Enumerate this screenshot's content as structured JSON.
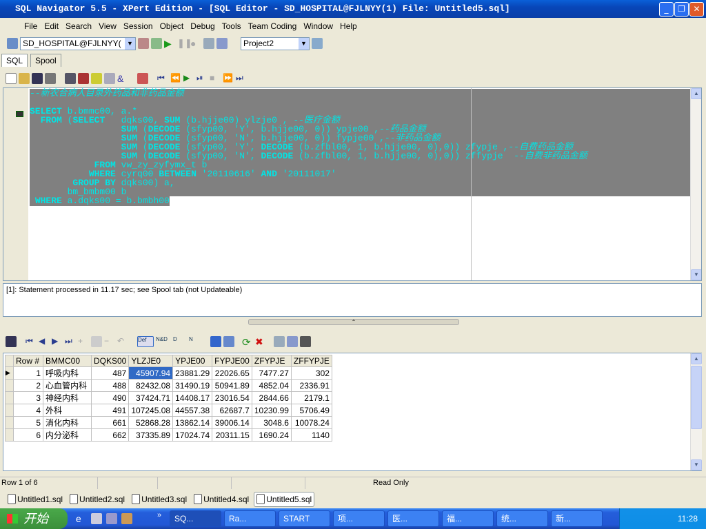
{
  "window": {
    "title": "SQL Navigator 5.5 - XPert Edition - [SQL Editor - SD_HOSPITAL@FJLNYY(1) File: Untitled5.sql]",
    "buttons": [
      "_",
      "❐",
      "✕"
    ]
  },
  "menu": [
    "File",
    "Edit",
    "Search",
    "View",
    "Session",
    "Object",
    "Debug",
    "Tools",
    "Team Coding",
    "Window",
    "Help"
  ],
  "toolbar": {
    "session": "SD_HOSPITAL@FJLNYY(",
    "project": "Project2"
  },
  "tabs": [
    {
      "label": "SQL",
      "active": true
    },
    {
      "label": "Spool",
      "active": false
    }
  ],
  "editor": {
    "lines": [
      [
        [
          "--新农合病人目录外药品和非药品金额",
          "cm"
        ]
      ],
      [],
      [
        [
          "SELECT",
          "kw"
        ],
        [
          " b.bmmc00, a.*",
          ""
        ]
      ],
      [
        [
          "  ",
          ""
        ],
        [
          "FROM",
          "kw"
        ],
        [
          " (",
          ""
        ],
        [
          "SELECT",
          "kw"
        ],
        [
          "   dqks00, ",
          ""
        ],
        [
          "SUM",
          "kw"
        ],
        [
          " (b.hjje00) ylzje0 , ",
          ""
        ],
        [
          "--医疗金额",
          "cm"
        ]
      ],
      [
        [
          "                 ",
          ""
        ],
        [
          "SUM",
          "kw"
        ],
        [
          " (",
          ""
        ],
        [
          "DECODE",
          "kw"
        ],
        [
          " (sfyp00, 'Y', b.hjje00, 0)) ypje00 ,",
          ""
        ],
        [
          "--药品金额",
          "cm"
        ]
      ],
      [
        [
          "                 ",
          ""
        ],
        [
          "SUM",
          "kw"
        ],
        [
          " (",
          ""
        ],
        [
          "DECODE",
          "kw"
        ],
        [
          " (sfyp00, 'N', b.hjje00, 0)) fypje00 ,",
          ""
        ],
        [
          "--非药品金额",
          "cm"
        ]
      ],
      [
        [
          "                 ",
          ""
        ],
        [
          "SUM",
          "kw"
        ],
        [
          " (",
          ""
        ],
        [
          "DECODE",
          "kw"
        ],
        [
          " (sfyp00, 'Y', ",
          ""
        ],
        [
          "DECODE",
          "kw"
        ],
        [
          " (b.zfbl00, 1, b.hjje00, 0),0)) zfypje ,",
          ""
        ],
        [
          "--自费药品金额",
          "cm"
        ]
      ],
      [
        [
          "                 ",
          ""
        ],
        [
          "SUM",
          "kw"
        ],
        [
          " (",
          ""
        ],
        [
          "DECODE",
          "kw"
        ],
        [
          " (sfyp00, 'N', ",
          ""
        ],
        [
          "DECODE",
          "kw"
        ],
        [
          " (b.zfbl00, 1, b.hjje00, 0),0)) zffypje  ",
          ""
        ],
        [
          "--自费非药品金额",
          "cm"
        ]
      ],
      [
        [
          "            ",
          ""
        ],
        [
          "FROM",
          "kw"
        ],
        [
          " vw_zy_zyfymx_t b",
          ""
        ]
      ],
      [
        [
          "           ",
          ""
        ],
        [
          "WHERE",
          "kw"
        ],
        [
          " cyrq00 ",
          ""
        ],
        [
          "BETWEEN",
          "kw"
        ],
        [
          " '20110616' ",
          ""
        ],
        [
          "AND",
          "kw"
        ],
        [
          " '20111017'",
          ""
        ]
      ],
      [
        [
          "        ",
          ""
        ],
        [
          "GROUP BY",
          "kw"
        ],
        [
          " dqks00) a,",
          ""
        ]
      ],
      [
        [
          "       bm_bmbm00 b",
          ""
        ]
      ],
      [
        [
          " ",
          ""
        ],
        [
          "WHERE",
          "kw"
        ],
        [
          " a.dqks00 = b.bmbh00",
          ""
        ]
      ]
    ],
    "selection_color": "#808080",
    "text_color": "#00e5e5"
  },
  "message": "[1]: Statement processed in 11.17 sec; see Spool tab (not Updateable)",
  "grid": {
    "columns": [
      "Row #",
      "BMMC00",
      "DQKS00",
      "YLZJE0",
      "YPJE00",
      "FYPJE00",
      "ZFYPJE",
      "ZFFYPJE"
    ],
    "rows": [
      [
        "1",
        "呼吸内科",
        "487",
        "45907.94",
        "23881.29",
        "22026.65",
        "7477.27",
        "302"
      ],
      [
        "2",
        "心血管内科",
        "488",
        "82432.08",
        "31490.19",
        "50941.89",
        "4852.04",
        "2336.91"
      ],
      [
        "3",
        "神经内科",
        "490",
        "37424.71",
        "14408.17",
        "23016.54",
        "2844.66",
        "2179.1"
      ],
      [
        "4",
        "外科",
        "491",
        "107245.08",
        "44557.38",
        "62687.7",
        "10230.99",
        "5706.49"
      ],
      [
        "5",
        "消化内科",
        "661",
        "52868.28",
        "13862.14",
        "39006.14",
        "3048.6",
        "10078.24"
      ],
      [
        "6",
        "内分泌科",
        "662",
        "37335.89",
        "17024.74",
        "20311.15",
        "1690.24",
        "1140"
      ]
    ],
    "selected_row": 1,
    "toolbar_labels": [
      "Def",
      "N&D",
      "D",
      "N"
    ]
  },
  "status": {
    "row": "Row 1 of 6",
    "mode": "Read Only"
  },
  "file_tabs": [
    {
      "label": "Untitled1.sql"
    },
    {
      "label": "Untitled2.sql"
    },
    {
      "label": "Untitled3.sql"
    },
    {
      "label": "Untitled4.sql"
    },
    {
      "label": "Untitled5.sql",
      "active": true
    }
  ],
  "taskbar": {
    "start": "开始",
    "items": [
      "SQ...",
      "Ra...",
      "START",
      "项...",
      "医...",
      "福...",
      "统...",
      "新..."
    ],
    "clock": "11:28"
  }
}
